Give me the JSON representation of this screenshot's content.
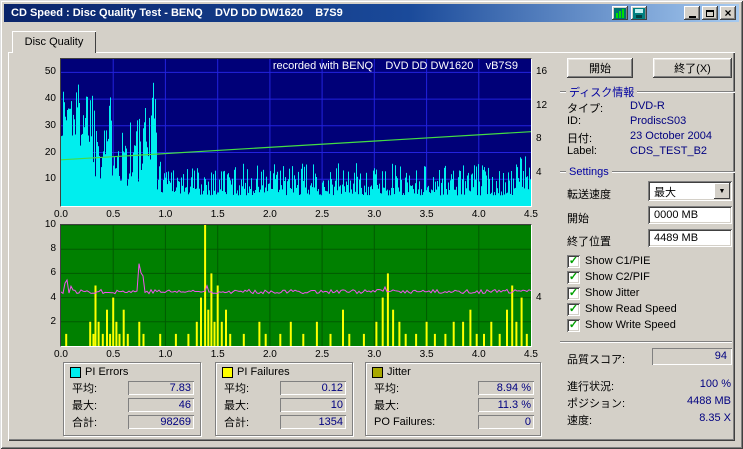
{
  "window": {
    "title": "CD Speed : Disc Quality Test - BENQ    DVD DD DW1620    B7S9"
  },
  "tabs": [
    {
      "label": "Disc Quality"
    }
  ],
  "right_panel": {
    "start_button": "開始",
    "exit_button": "終了(X)",
    "disc_info": {
      "header": "ディスク情報",
      "rows": [
        {
          "label": "タイプ:",
          "value": "DVD-R"
        },
        {
          "label": "ID:",
          "value": "ProdiscS03"
        },
        {
          "label": "日付:",
          "value": "23 October 2004"
        },
        {
          "label": "Label:",
          "value": "CDS_TEST_B2"
        }
      ]
    },
    "settings": {
      "header": "Settings",
      "speed_label": "転送速度",
      "speed_value": "最大",
      "start_label": "開始",
      "start_value": "0000 MB",
      "end_label": "終了位置",
      "end_value": "4489 MB",
      "checkboxes": [
        {
          "label": "Show C1/PIE",
          "checked": true
        },
        {
          "label": "Show C2/PIF",
          "checked": true
        },
        {
          "label": "Show Jitter",
          "checked": true
        },
        {
          "label": "Show Read Speed",
          "checked": true
        },
        {
          "label": "Show Write Speed",
          "checked": true
        }
      ]
    },
    "quality_score": {
      "label": "品質スコア:",
      "value": "94"
    },
    "status_rows": [
      {
        "label": "進行状況:",
        "value": "100 %"
      },
      {
        "label": "ポジション:",
        "value": "4488 MB"
      },
      {
        "label": "速度:",
        "value": "8.35 X"
      }
    ]
  },
  "stats_boxes": [
    {
      "name": "PI Errors",
      "swatch": "#00eeee",
      "rows": [
        {
          "label": "平均:",
          "value": "7.83"
        },
        {
          "label": "最大:",
          "value": "46"
        },
        {
          "label": "合計:",
          "value": "98269"
        }
      ]
    },
    {
      "name": "PI Failures",
      "swatch": "#ffff00",
      "rows": [
        {
          "label": "平均:",
          "value": "0.12"
        },
        {
          "label": "最大:",
          "value": "10"
        },
        {
          "label": "合計:",
          "value": "1354"
        }
      ]
    },
    {
      "name": "Jitter",
      "swatch": "#a8a800",
      "rows": [
        {
          "label": "平均:",
          "value": "8.94 %"
        },
        {
          "label": "最大:",
          "value": "11.3 %"
        },
        {
          "label": "PO Failures:",
          "value": "0"
        }
      ]
    }
  ],
  "chart_data": [
    {
      "type": "bar",
      "title": "recorded with BENQ    DVD DD DW1620    vB7S9",
      "x_max": 4.5,
      "x_ticks": [
        "0.0",
        "0.5",
        "1.0",
        "1.5",
        "2.0",
        "2.5",
        "3.0",
        "3.5",
        "4.0",
        "4.5"
      ],
      "left_ticks": [
        50,
        40,
        30,
        20,
        10
      ],
      "left_max": 55,
      "right_ticks": [
        16,
        12,
        8,
        4
      ],
      "right_max": 17.6,
      "bg": "#000078",
      "grid": "#2222dd",
      "series": [
        {
          "name": "PI Errors",
          "kind": "bars-profile",
          "color": "#00eeee",
          "seed": 1337,
          "profile": [
            [
              0,
              0.3,
              18,
              47,
              0.75
            ],
            [
              0.3,
              0.55,
              10,
              42,
              1.0
            ],
            [
              0.55,
              0.84,
              7,
              38,
              1.35
            ],
            [
              0.84,
              0.91,
              14,
              48,
              0.55
            ],
            [
              0.91,
              1.1,
              5,
              18,
              1.4
            ],
            [
              1.1,
              4.38,
              4,
              16,
              1.6
            ],
            [
              4.38,
              4.5,
              5,
              19,
              1.1
            ]
          ]
        },
        {
          "name": "Write Speed",
          "kind": "line",
          "color": "#44dd44",
          "points": [
            [
              0,
              17.3
            ],
            [
              4.5,
              27.8
            ]
          ]
        }
      ]
    },
    {
      "type": "bar",
      "title": "",
      "x_max": 4.5,
      "x_ticks": [
        "0.0",
        "0.5",
        "1.0",
        "1.5",
        "2.0",
        "2.5",
        "3.0",
        "3.5",
        "4.0",
        "4.5"
      ],
      "left_ticks": [
        10,
        8,
        6,
        4,
        2
      ],
      "left_max": 10,
      "right_ticks": [
        4
      ],
      "right_max": 10,
      "bg": "#008000",
      "grid": "#005a00",
      "series": [
        {
          "name": "PI Failures",
          "kind": "bars-list",
          "color": "#ffff00",
          "bars": [
            [
              0.05,
              1
            ],
            [
              0.28,
              2
            ],
            [
              0.31,
              1
            ],
            [
              0.33,
              5
            ],
            [
              0.36,
              2
            ],
            [
              0.4,
              1
            ],
            [
              0.44,
              3
            ],
            [
              0.47,
              1
            ],
            [
              0.5,
              4
            ],
            [
              0.53,
              2
            ],
            [
              0.56,
              1
            ],
            [
              0.6,
              3
            ],
            [
              0.64,
              1
            ],
            [
              0.75,
              2
            ],
            [
              0.79,
              1
            ],
            [
              0.95,
              1
            ],
            [
              1.1,
              1
            ],
            [
              1.22,
              1
            ],
            [
              1.3,
              2
            ],
            [
              1.34,
              4
            ],
            [
              1.38,
              10
            ],
            [
              1.41,
              3
            ],
            [
              1.44,
              6
            ],
            [
              1.47,
              2
            ],
            [
              1.5,
              5
            ],
            [
              1.54,
              2
            ],
            [
              1.58,
              3
            ],
            [
              1.62,
              1
            ],
            [
              1.75,
              1
            ],
            [
              1.9,
              2
            ],
            [
              1.96,
              1
            ],
            [
              2.1,
              1
            ],
            [
              2.2,
              2
            ],
            [
              2.32,
              1
            ],
            [
              2.45,
              2
            ],
            [
              2.58,
              1
            ],
            [
              2.7,
              3
            ],
            [
              2.76,
              1
            ],
            [
              2.9,
              1
            ],
            [
              3.02,
              2
            ],
            [
              3.08,
              4
            ],
            [
              3.13,
              6
            ],
            [
              3.18,
              3
            ],
            [
              3.24,
              2
            ],
            [
              3.3,
              1
            ],
            [
              3.4,
              1
            ],
            [
              3.5,
              2
            ],
            [
              3.58,
              1
            ],
            [
              3.68,
              1
            ],
            [
              3.76,
              2
            ],
            [
              3.85,
              2
            ],
            [
              3.92,
              3
            ],
            [
              3.98,
              1
            ],
            [
              4.05,
              1
            ],
            [
              4.12,
              2
            ],
            [
              4.2,
              1
            ],
            [
              4.27,
              3
            ],
            [
              4.32,
              5
            ],
            [
              4.36,
              2
            ],
            [
              4.41,
              4
            ],
            [
              4.46,
              1
            ]
          ]
        },
        {
          "name": "Jitter",
          "kind": "noisy-line",
          "color": "#ee55ee",
          "seed": 77,
          "base": 4.5,
          "noise": 0.34,
          "spikes": [
            [
              0.05,
              5.9
            ],
            [
              0.1,
              5.2
            ],
            [
              0.45,
              5.0
            ],
            [
              0.75,
              7.0
            ],
            [
              0.78,
              6.1
            ],
            [
              1.4,
              5.1
            ],
            [
              2.25,
              4.9
            ],
            [
              3.1,
              5.0
            ],
            [
              4.2,
              4.8
            ]
          ]
        }
      ]
    }
  ]
}
